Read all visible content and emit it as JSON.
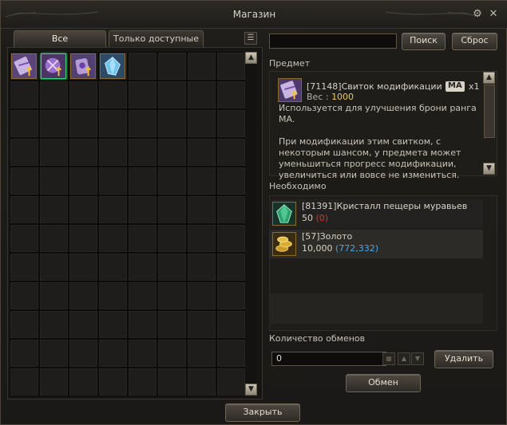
{
  "window": {
    "title": "Магазин"
  },
  "tabs": [
    {
      "label": "Все",
      "active": true
    },
    {
      "label": "Только доступные",
      "active": false
    }
  ],
  "grid": {
    "items": [
      {
        "name": "Свиток модификации (фиолетовый, со стрелкой)",
        "icon": "scroll-upgrade-icon",
        "selected": false
      },
      {
        "name": "Свиток модификации",
        "icon": "scroll-upgrade-icon",
        "selected": true
      },
      {
        "name": "Свиток модификации (фиолетовый)",
        "icon": "scroll-upgrade-icon",
        "selected": false
      },
      {
        "name": "Кристалл (синий)",
        "icon": "crystal-icon",
        "selected": false
      }
    ]
  },
  "search": {
    "value": "",
    "search_label": "Поиск",
    "reset_label": "Сброс"
  },
  "item_section": {
    "heading": "Предмет",
    "name": "[71148]Свиток модификации ..",
    "badge": "MA",
    "quantity": "x1",
    "weight_label": "Вес : ",
    "weight_value": "1000",
    "description_1": "Используется для улучшения брони ранга MA.",
    "description_2": "При модификации этим свитком, с некоторым шансом, у предмета может уменьшиться прогресс модификации, увеличиться или вовсе не измениться."
  },
  "requirements": {
    "heading": "Необходимо",
    "items": [
      {
        "name": "[81391]Кристалл пещеры муравьев",
        "amount": "50",
        "owned": "(0)",
        "owned_color": "#e0302a",
        "icon": "crystal-icon"
      },
      {
        "name": "[57]Золото",
        "amount": "10,000",
        "owned": "(772,332)",
        "owned_color": "#47a7e8",
        "icon": "gold-coins-icon"
      }
    ]
  },
  "exchange": {
    "count_label": "Количество обменов",
    "count_value": "0",
    "delete_label": "Удалить",
    "exchange_label": "Обмен"
  },
  "footer": {
    "close_label": "Закрыть"
  },
  "colors": {
    "accent_gold": "#8a6a2a",
    "selection": "#3fd07a"
  }
}
